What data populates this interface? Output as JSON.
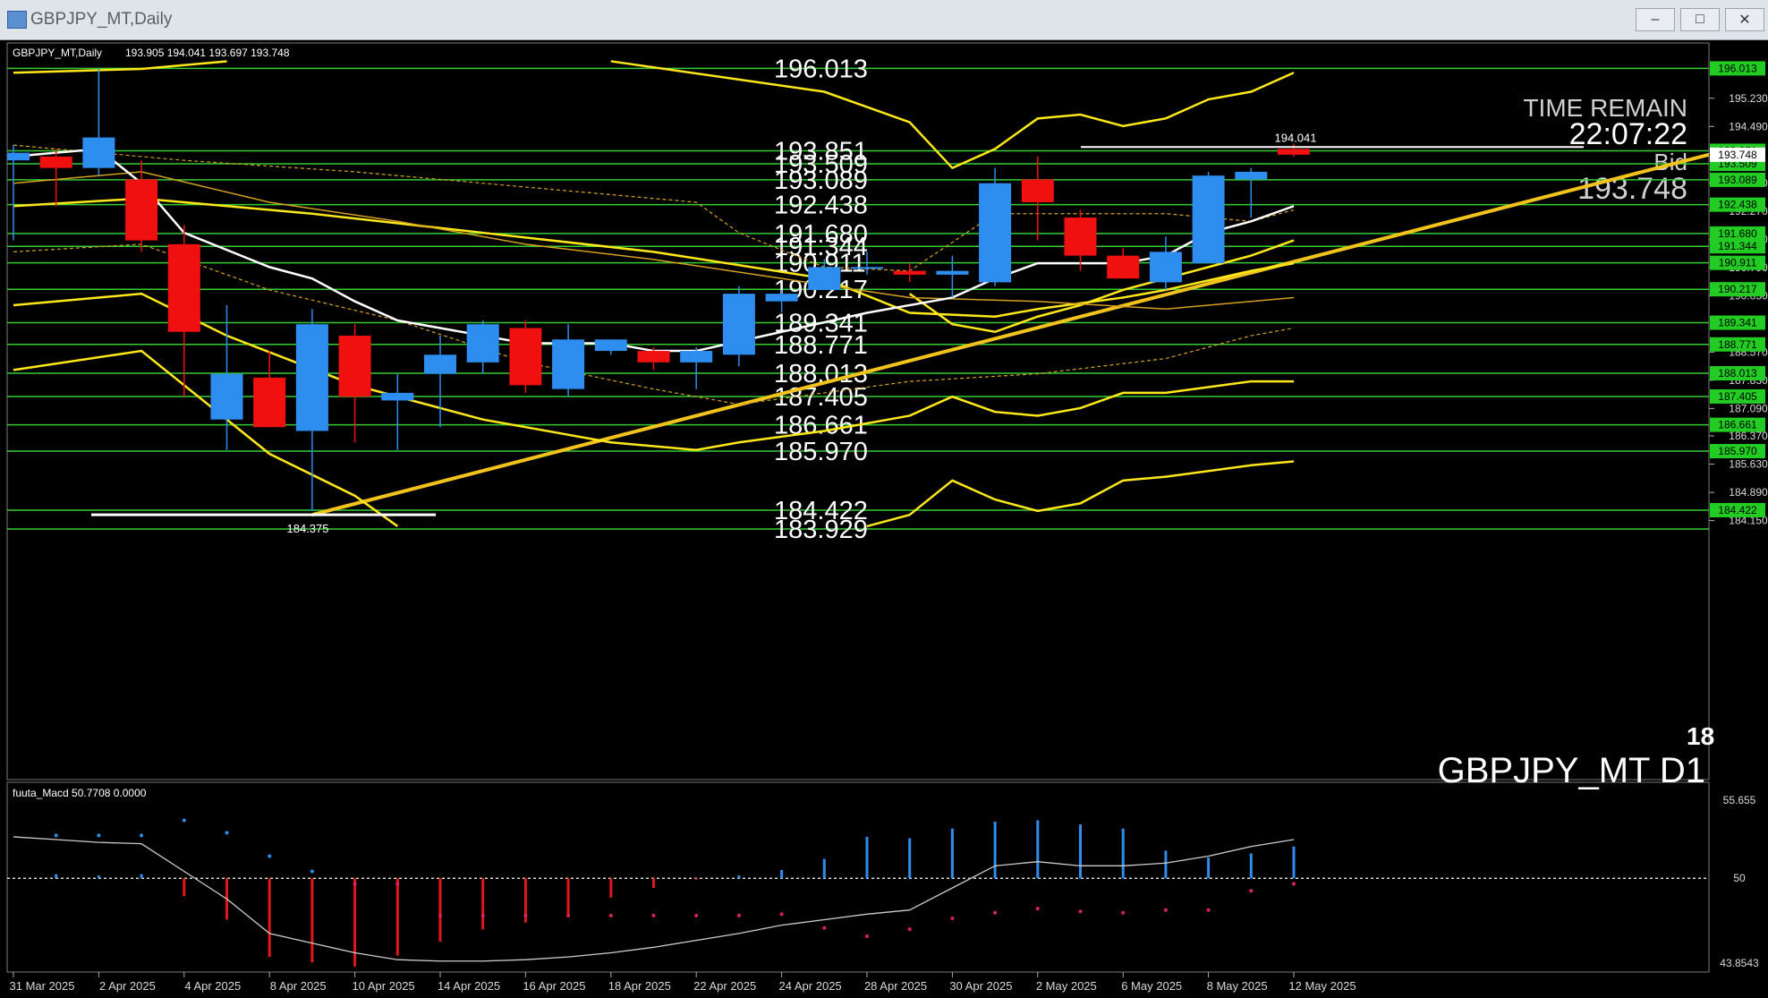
{
  "window": {
    "title": "GBPJPY_MT,Daily",
    "buttons": [
      {
        "name": "minimize-button",
        "glyph": "–"
      },
      {
        "name": "maximize-button",
        "glyph": "□"
      },
      {
        "name": "close-button",
        "glyph": "✕"
      }
    ]
  },
  "chart_data": {
    "type": "candlestick",
    "symbol_label": "GBPJPY_MT,Daily",
    "ohlc_label": "193.905 194.041 193.697 193.748",
    "watermark": "GBPJPY_MT D1",
    "watermark_partial": "18",
    "bid_panel": {
      "time_remain_label": "TIME REMAIN",
      "time_remain": "22:07:22",
      "bid_label": "Bid",
      "bid": "193.748"
    },
    "ylim": [
      184.0,
      196.2
    ],
    "y_ticks": [
      {
        "v": 195.23,
        "t": "195.230"
      },
      {
        "v": 194.49,
        "t": "194.490"
      },
      {
        "v": 193.01,
        "t": "193.010"
      },
      {
        "v": 192.27,
        "t": "192.270"
      },
      {
        "v": 191.53,
        "t": "191.530"
      },
      {
        "v": 190.79,
        "t": "190.790"
      },
      {
        "v": 190.05,
        "t": "190.050"
      },
      {
        "v": 188.57,
        "t": "188.570"
      },
      {
        "v": 187.83,
        "t": "187.830"
      },
      {
        "v": 187.09,
        "t": "187.090"
      },
      {
        "v": 186.37,
        "t": "186.370"
      },
      {
        "v": 185.63,
        "t": "185.630"
      },
      {
        "v": 184.89,
        "t": "184.890"
      },
      {
        "v": 184.15,
        "t": "184.150"
      }
    ],
    "levels": [
      "196.013",
      "193.851",
      "193.509",
      "193.089",
      "192.438",
      "191.680",
      "191.344",
      "190.911",
      "190.217",
      "189.341",
      "188.771",
      "188.013",
      "187.405",
      "186.661",
      "185.970",
      "184.422",
      "183.929"
    ],
    "level_tags": [
      {
        "v": 193.851,
        "t": "193.851"
      },
      {
        "v": 193.509,
        "t": "193.509"
      },
      {
        "v": 193.089,
        "t": "193.089"
      },
      {
        "v": 192.438,
        "t": "192.438"
      },
      {
        "v": 191.68,
        "t": "191.680"
      },
      {
        "v": 191.344,
        "t": "191.344"
      },
      {
        "v": 190.911,
        "t": "190.911"
      },
      {
        "v": 190.217,
        "t": "190.217"
      },
      {
        "v": 189.341,
        "t": "189.341"
      },
      {
        "v": 188.771,
        "t": "188.771"
      },
      {
        "v": 188.013,
        "t": "188.013"
      },
      {
        "v": 187.405,
        "t": "187.405"
      },
      {
        "v": 186.661,
        "t": "186.661"
      },
      {
        "v": 185.97,
        "t": "185.970"
      },
      {
        "v": 184.422,
        "t": "184.422"
      },
      {
        "v": 196.013,
        "t": "196.013"
      }
    ],
    "marker_high": {
      "v": 194.041,
      "t": "194.041"
    },
    "marker_low": {
      "v": 184.375,
      "t": "184.375"
    },
    "candles": [
      {
        "o": 193.6,
        "h": 194.0,
        "l": 191.5,
        "c": 193.8
      },
      {
        "o": 193.7,
        "h": 193.9,
        "l": 192.4,
        "c": 193.4
      },
      {
        "o": 193.4,
        "h": 196.0,
        "l": 193.2,
        "c": 194.2
      },
      {
        "o": 193.1,
        "h": 193.6,
        "l": 191.2,
        "c": 191.5
      },
      {
        "o": 191.4,
        "h": 191.9,
        "l": 187.4,
        "c": 189.1
      },
      {
        "o": 186.8,
        "h": 189.8,
        "l": 186.0,
        "c": 188.0
      },
      {
        "o": 187.9,
        "h": 188.6,
        "l": 186.6,
        "c": 186.6
      },
      {
        "o": 186.5,
        "h": 189.7,
        "l": 184.4,
        "c": 189.3
      },
      {
        "o": 189.0,
        "h": 189.3,
        "l": 186.2,
        "c": 187.4
      },
      {
        "o": 187.3,
        "h": 188.0,
        "l": 186.0,
        "c": 187.5
      },
      {
        "o": 188.0,
        "h": 189.0,
        "l": 186.6,
        "c": 188.5
      },
      {
        "o": 188.3,
        "h": 189.4,
        "l": 188.0,
        "c": 189.3
      },
      {
        "o": 189.2,
        "h": 189.4,
        "l": 187.5,
        "c": 187.7
      },
      {
        "o": 187.6,
        "h": 189.3,
        "l": 187.4,
        "c": 188.9
      },
      {
        "o": 188.6,
        "h": 188.9,
        "l": 188.5,
        "c": 188.9
      },
      {
        "o": 188.6,
        "h": 188.7,
        "l": 188.1,
        "c": 188.3
      },
      {
        "o": 188.3,
        "h": 188.7,
        "l": 187.6,
        "c": 188.6
      },
      {
        "o": 188.5,
        "h": 190.3,
        "l": 188.2,
        "c": 190.1
      },
      {
        "o": 189.9,
        "h": 190.2,
        "l": 189.6,
        "c": 190.1
      },
      {
        "o": 190.2,
        "h": 191.0,
        "l": 190.2,
        "c": 190.8
      },
      {
        "o": 190.8,
        "h": 191.2,
        "l": 190.6,
        "c": 190.8
      },
      {
        "o": 190.7,
        "h": 190.9,
        "l": 190.4,
        "c": 190.6
      },
      {
        "o": 190.6,
        "h": 191.1,
        "l": 190.0,
        "c": 190.7
      },
      {
        "o": 190.4,
        "h": 193.4,
        "l": 190.3,
        "c": 193.0
      },
      {
        "o": 193.1,
        "h": 193.7,
        "l": 191.5,
        "c": 192.5
      },
      {
        "o": 192.1,
        "h": 192.3,
        "l": 190.7,
        "c": 191.1
      },
      {
        "o": 191.1,
        "h": 191.3,
        "l": 190.5,
        "c": 190.5
      },
      {
        "o": 190.4,
        "h": 191.6,
        "l": 190.2,
        "c": 191.2
      },
      {
        "o": 190.9,
        "h": 193.3,
        "l": 190.9,
        "c": 193.2
      },
      {
        "o": 193.1,
        "h": 193.4,
        "l": 192.1,
        "c": 193.3
      },
      {
        "o": 193.9,
        "h": 194.041,
        "l": 193.697,
        "c": 193.748
      }
    ],
    "x_labels": [
      "31 Mar 2025",
      "2 Apr 2025",
      "4 Apr 2025",
      "8 Apr 2025",
      "10 Apr 2025",
      "14 Apr 2025",
      "16 Apr 2025",
      "18 Apr 2025",
      "22 Apr 2025",
      "24 Apr 2025",
      "28 Apr 2025",
      "30 Apr 2025",
      "2 May 2025",
      "6 May 2025",
      "8 May 2025",
      "12 May 2025"
    ],
    "macd": {
      "label": "fuuta_Macd 50.7708 0.0000",
      "ylim": [
        43.8543,
        55.655
      ],
      "y_ticks": [
        {
          "v": 55.655,
          "t": "55.655"
        },
        {
          "v": 50,
          "t": "50"
        },
        {
          "v": 43.8543,
          "t": "43.8543"
        }
      ],
      "hist": [
        50.3,
        50.2,
        50.3,
        48.7,
        47.0,
        44.3,
        43.9,
        43.6,
        44.4,
        45.4,
        46.3,
        46.8,
        47.4,
        48.6,
        49.3,
        49.9,
        50.2,
        50.6,
        51.4,
        53.0,
        52.9,
        53.6,
        54.1,
        54.2,
        53.9,
        53.6,
        52.0,
        51.5,
        51.8,
        52.3
      ],
      "dots": [
        53.1,
        53.1,
        53.1,
        54.2,
        53.3,
        51.6,
        50.5,
        49.6,
        49.6,
        47.3,
        47.3,
        47.3,
        47.3,
        47.3,
        47.3,
        47.3,
        47.3,
        47.4,
        46.4,
        45.8,
        46.3,
        47.1,
        47.5,
        47.8,
        47.6,
        47.5,
        47.7,
        47.7,
        49.1,
        49.6
      ],
      "line": [
        53.0,
        52.8,
        52.6,
        52.5,
        50.5,
        48.5,
        46.0,
        45.3,
        44.6,
        44.1,
        44.0,
        44.0,
        44.1,
        44.3,
        44.6,
        45.0,
        45.5,
        46.0,
        46.6,
        47.0,
        47.4,
        47.7,
        49.3,
        50.9,
        51.2,
        50.9,
        50.9,
        51.1,
        51.6,
        52.3,
        52.8
      ]
    }
  }
}
